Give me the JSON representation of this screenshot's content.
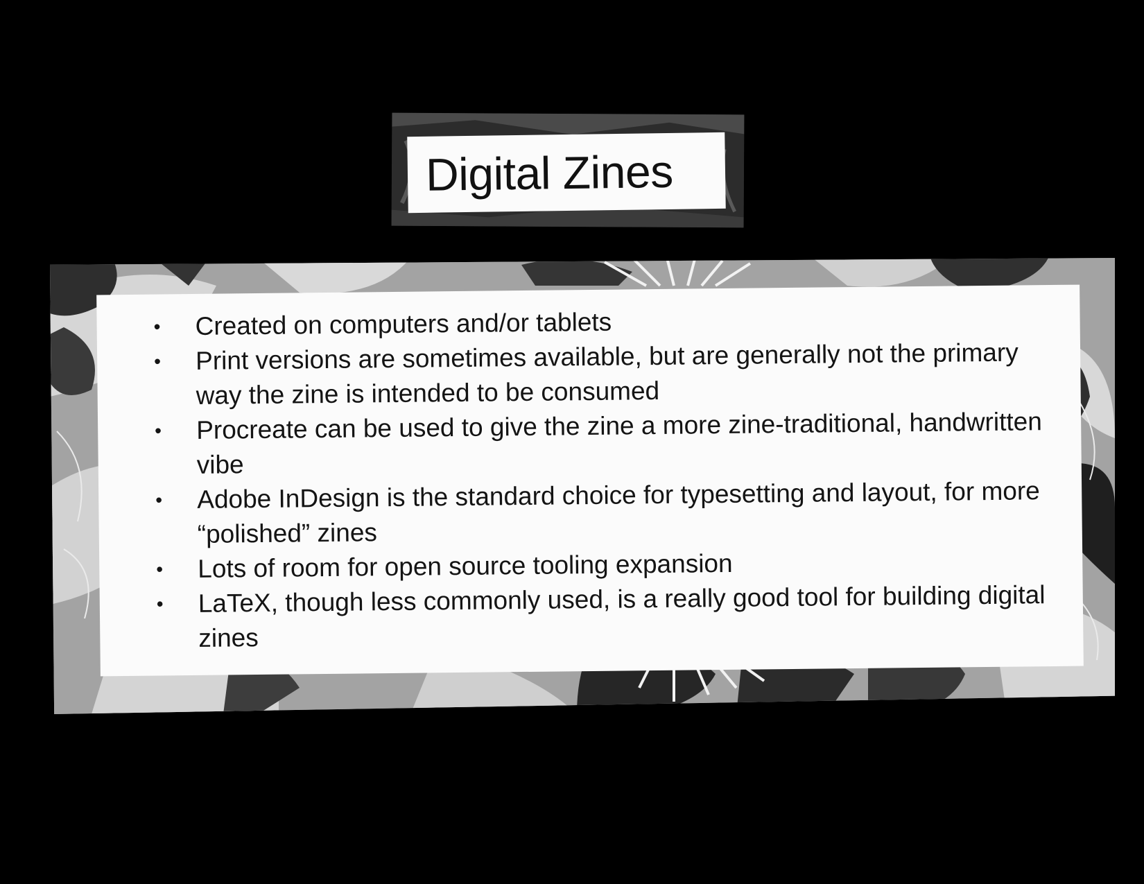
{
  "title": "Digital Zines",
  "bullets": [
    "Created on computers and/or tablets",
    "Print versions are sometimes available, but are generally not the primary way the zine is intended to be consumed",
    "Procreate can be used to give the zine a more zine-traditional, handwritten vibe",
    "Adobe InDesign is the standard choice for typesetting and layout, for more “polished” zines",
    "Lots of room for open source tooling expansion",
    "LaTeX, though less commonly used, is a really good tool for building digital zines"
  ],
  "colors": {
    "background": "#000000",
    "paper": "#fbfbfb",
    "text": "#141414",
    "pattern_light": "#d8d8d8",
    "pattern_mid": "#9d9d9d",
    "pattern_dark": "#2a2a2a"
  }
}
